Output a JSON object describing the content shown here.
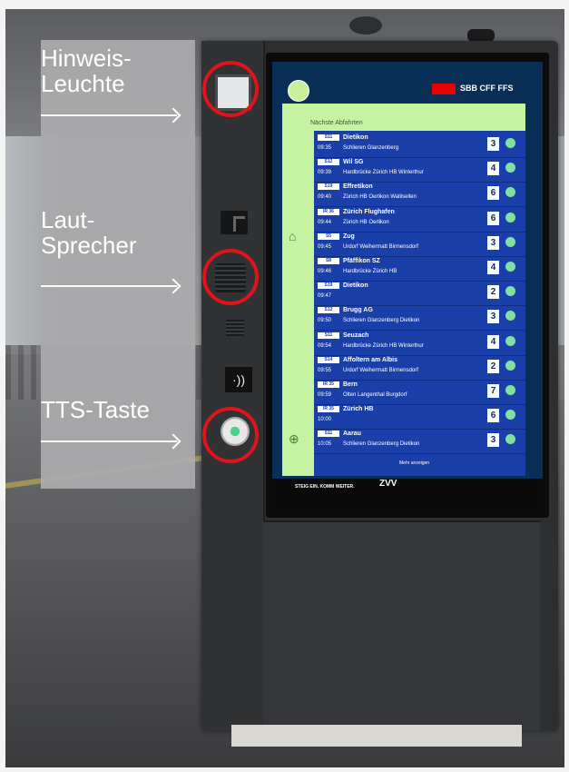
{
  "callouts": [
    {
      "line1": "Hinweis-",
      "line2": "Leuchte"
    },
    {
      "line1": "Laut-",
      "line2": "Sprecher"
    },
    {
      "line1": "TTS-Taste",
      "line2": ""
    }
  ],
  "screen": {
    "brand": "SBB CFF FFS",
    "heading": "Nächste Abfahrten",
    "departures": [
      {
        "line": "S11",
        "destination": "Dietikon",
        "time": "09:35",
        "via": "Schlieren  Glanzenberg",
        "track": "3"
      },
      {
        "line": "S12",
        "destination": "Wil SG",
        "time": "09:39",
        "via": "Hardbrücke  Zürich HB  Winterthur",
        "track": "4"
      },
      {
        "line": "S19",
        "destination": "Effretikon",
        "time": "09:40",
        "via": "Zürich HB  Oerlikon  Wallisellen",
        "track": "6"
      },
      {
        "line": "IR 36",
        "destination": "Zürich Flughafen",
        "time": "09:44",
        "via": "Zürich HB  Oerlikon",
        "track": "6"
      },
      {
        "line": "S5",
        "destination": "Zug",
        "time": "09:45",
        "via": "Urdorf  Weihermatt  Birmensdorf",
        "track": "3"
      },
      {
        "line": "S8",
        "destination": "Pfäffikon SZ",
        "time": "09:46",
        "via": "Hardbrücke  Zürich HB",
        "track": "4"
      },
      {
        "line": "S19",
        "destination": "Dietikon",
        "time": "09:47",
        "via": "",
        "track": "2"
      },
      {
        "line": "S12",
        "destination": "Brugg AG",
        "time": "09:50",
        "via": "Schlieren  Glanzenberg  Dietikon",
        "track": "3"
      },
      {
        "line": "S11",
        "destination": "Seuzach",
        "time": "09:54",
        "via": "Hardbrücke  Zürich HB  Winterthur",
        "track": "4"
      },
      {
        "line": "S14",
        "destination": "Affoltern am Albis",
        "time": "09:55",
        "via": "Urdorf  Weihermatt  Birmensdorf",
        "track": "2"
      },
      {
        "line": "IR 35",
        "destination": "Bern",
        "time": "09:59",
        "via": "Olten  Langenthal  Burgdorf",
        "track": "7"
      },
      {
        "line": "IR 35",
        "destination": "Zürich HB",
        "time": "10:00",
        "via": "",
        "track": "6"
      },
      {
        "line": "S11",
        "destination": "Aarau",
        "time": "10:05",
        "via": "Schlieren  Glanzenberg  Dietikon",
        "track": "3"
      }
    ],
    "more": "Mehr anzeigen",
    "footer_text": "STEIG EIN. KOMM WEITER.",
    "zvv": "ZVV"
  },
  "icons": {
    "nfc": "sound-waves-icon",
    "home": "home-icon",
    "globe": "globe-icon"
  },
  "colors": {
    "highlight_ring": "#e0141a",
    "screen_bg": "#0a2f57",
    "list_bg": "#1b3fa8",
    "accent_green": "#c6f3a2",
    "sbb_red": "#eb0000"
  }
}
